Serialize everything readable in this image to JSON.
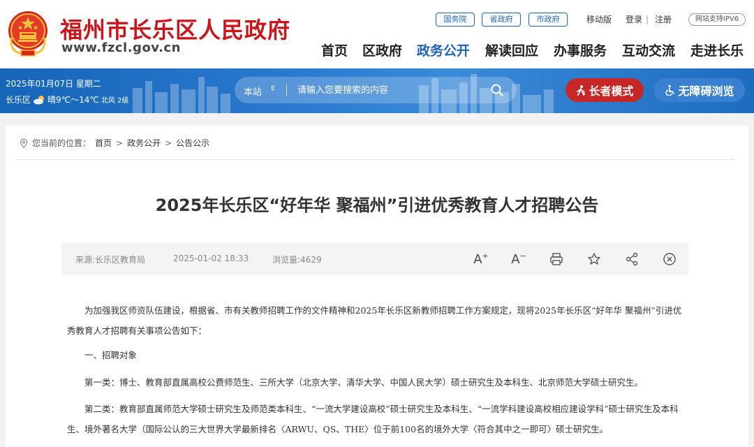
{
  "header": {
    "site_title": "福州市长乐区人民政府",
    "site_url": "www.fzcl.gov.cn",
    "gov_links": [
      "国务院",
      "省政府",
      "市政府"
    ],
    "mobile": "移动版",
    "login": "登录",
    "register": "注册",
    "ipv6": "网站支持IPV6",
    "nav": [
      "首页",
      "区政府",
      "政务公开",
      "解读回应",
      "办事服务",
      "互动交流",
      "走进长乐"
    ]
  },
  "banner": {
    "date": "2025年01月07日 星期二",
    "location": "长乐区",
    "weather": "晴9℃～14℃",
    "wind": "北风 2级",
    "search_scope": "本站",
    "search_placeholder": "请输入您要搜索的内容",
    "elder_mode": "长者模式",
    "accessible": "无障碍浏览"
  },
  "breadcrumb": {
    "prefix": "您当前的位置：",
    "items": [
      "首页",
      "政务公开",
      "公告公示"
    ]
  },
  "article": {
    "title": "2025年长乐区“好年华 聚福州”引进优秀教育人才招聘公告",
    "source": "来源:长乐区教育局",
    "date": "2025-01-02 18:33",
    "views": "浏览量:4629",
    "paragraphs": [
      "为加强我区师资队伍建设，根据省、市有关教师招聘工作的文件精神和2025年长乐区新教师招聘工作方案规定，现将2025年长乐区“好年华 聚福州”引进优秀教育人才招聘有关事项公告如下：",
      "一、招聘对象",
      "第一类：博士、教育部直属高校公费师范生、三所大学（北京大学、清华大学、中国人民大学）硕士研究生及本科生、北京师范大学硕士研究生。",
      "第二类：教育部直属师范大学硕士研究生及师范类本科生、“一流大学建设高校”硕士研究生及本科生、“一流学科建设高校相应建设学科”硕士研究生及本科生、境外著名大学（国际公认的三大世界大学最新排名〈ARWU、QS、THE〉位于前100名的境外大学〈符合其中之一即可〉硕士研究生。"
    ]
  },
  "colors": {
    "brand_red": "#c8161d",
    "brand_blue": "#1e64b4",
    "elder_red": "#c62828"
  }
}
